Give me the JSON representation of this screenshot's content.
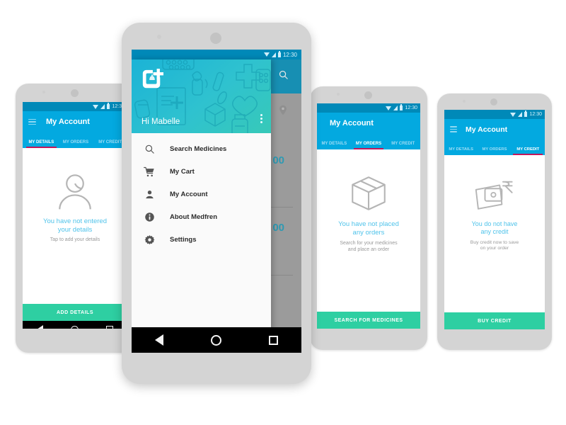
{
  "app": {
    "name": "Medfren",
    "accent_blue": "#03a9e0",
    "accent_blue_dark": "#0089b8",
    "accent_green": "#2ecfa2",
    "tab_indicator": "#c2185b",
    "empty_text_color": "#4fc3ea"
  },
  "statusbar": {
    "time": "12:30"
  },
  "screens": [
    {
      "id": "my-details",
      "title": "My Account",
      "tabs": [
        {
          "label": "MY DETAILS",
          "active": true
        },
        {
          "label": "MY ORDERS",
          "active": false
        },
        {
          "label": "MY CREDIT",
          "active": false
        }
      ],
      "icon": "person-icon",
      "empty_title": "You have not entered\nyour details",
      "empty_sub": "Tap to add your details",
      "cta": "ADD DETAILS"
    },
    {
      "id": "my-orders",
      "title": "My Account",
      "tabs": [
        {
          "label": "MY DETAILS",
          "active": false
        },
        {
          "label": "MY ORDERS",
          "active": true
        },
        {
          "label": "MY CREDIT",
          "active": false
        }
      ],
      "icon": "box-icon",
      "empty_title": "You have not placed\nany orders",
      "empty_sub": "Search for your medicines\nand place an order",
      "cta": "SEARCH FOR MEDICINES"
    },
    {
      "id": "my-credit",
      "title": "My Account",
      "tabs": [
        {
          "label": "MY DETAILS",
          "active": false
        },
        {
          "label": "MY ORDERS",
          "active": false
        },
        {
          "label": "MY CREDIT",
          "active": true
        }
      ],
      "icon": "wallet-rupee-icon",
      "empty_title": "You do not have\nany credit",
      "empty_sub": "Buy credit now to save\non your order",
      "cta": "BUY CREDIT"
    }
  ],
  "drawer": {
    "brand_icon": "medfren-logo-icon",
    "greeting": "Hi Mabelle",
    "overflow_icon": "kebab-menu-icon",
    "items": [
      {
        "label": "Search Medicines",
        "icon": "search-icon"
      },
      {
        "label": "My Cart",
        "icon": "cart-icon"
      },
      {
        "label": "My Account",
        "icon": "person-icon"
      },
      {
        "label": "About Medfren",
        "icon": "info-icon"
      },
      {
        "label": "Settings",
        "icon": "gear-icon"
      }
    ]
  },
  "behind_drawer": {
    "search_icon": "search-icon",
    "location_icon": "location-pin-icon",
    "price_1": "00",
    "price_2": "00"
  },
  "navbar": {
    "back": "back-icon",
    "home": "home-icon",
    "recents": "recents-icon"
  }
}
